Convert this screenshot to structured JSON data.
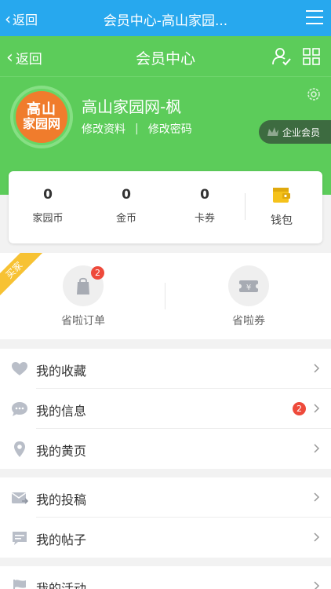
{
  "topbar": {
    "back_label": "返回",
    "title": "会员中心-高山家园..."
  },
  "header": {
    "back_label": "返回",
    "title": "会员中心"
  },
  "profile": {
    "name": "高山家园网-枫",
    "edit_profile": "修改资料",
    "separator": "|",
    "change_password": "修改密码",
    "member_badge": "企业会员",
    "avatar_line1": "高山",
    "avatar_line2": "家园网"
  },
  "stats": [
    {
      "value": "0",
      "label": "家园币"
    },
    {
      "value": "0",
      "label": "金币"
    },
    {
      "value": "0",
      "label": "卡券"
    }
  ],
  "wallet": {
    "label": "钱包"
  },
  "buyer": {
    "ribbon": "买家",
    "items": [
      {
        "label": "省啦订单",
        "badge": "2",
        "icon": "shopping-bag-icon"
      },
      {
        "label": "省啦券",
        "icon": "coupon-icon"
      }
    ]
  },
  "menu": {
    "group1": [
      {
        "label": "我的收藏",
        "icon": "heart-icon"
      },
      {
        "label": "我的信息",
        "icon": "chat-icon",
        "badge": "2"
      },
      {
        "label": "我的黄页",
        "icon": "location-pin-icon"
      }
    ],
    "group2": [
      {
        "label": "我的投稿",
        "icon": "mail-send-icon"
      },
      {
        "label": "我的帖子",
        "icon": "post-icon"
      }
    ],
    "group3": [
      {
        "label": "我的活动",
        "icon": "flag-icon"
      }
    ]
  },
  "colors": {
    "top_bar": "#27a8ee",
    "green": "#5ccc5a",
    "badge_red": "#ee4a3b",
    "ribbon": "#f7c233",
    "icon_gray": "#b9bec8"
  }
}
